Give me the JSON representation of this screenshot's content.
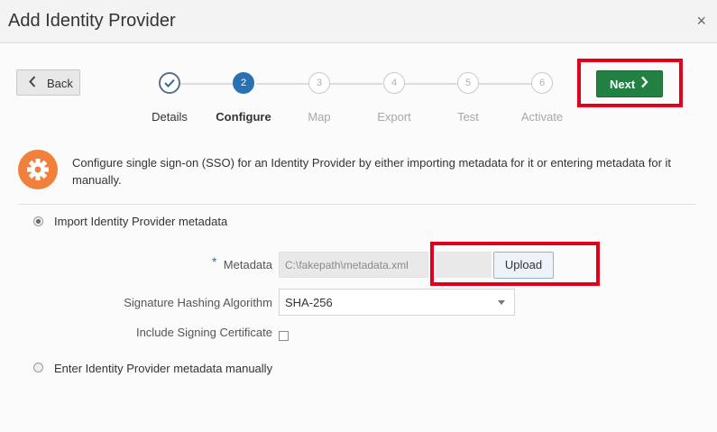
{
  "dialog": {
    "title": "Add Identity Provider",
    "close_glyph": "×"
  },
  "nav": {
    "back_label": "Back",
    "next_label": "Next"
  },
  "train": {
    "steps": [
      {
        "label": "Details",
        "number": "1",
        "state": "done"
      },
      {
        "label": "Configure",
        "number": "2",
        "state": "current"
      },
      {
        "label": "Map",
        "number": "3",
        "state": "future"
      },
      {
        "label": "Export",
        "number": "4",
        "state": "future"
      },
      {
        "label": "Test",
        "number": "5",
        "state": "future"
      },
      {
        "label": "Activate",
        "number": "6",
        "state": "future"
      }
    ]
  },
  "info": {
    "icon": "gear-icon",
    "text": "Configure single sign-on (SSO) for an Identity Provider by either importing metadata for it or entering metadata for it manually."
  },
  "options": {
    "import_label": "Import Identity Provider metadata",
    "import_selected": true,
    "manual_label": "Enter Identity Provider metadata manually",
    "manual_selected": false
  },
  "form": {
    "metadata_label": "Metadata",
    "required_marker": "*",
    "metadata_value": "C:\\fakepath\\metadata.xml",
    "upload_label": "Upload",
    "hash_label": "Signature Hashing Algorithm",
    "hash_value": "SHA-256",
    "signing_label": "Include Signing Certificate",
    "signing_checked": false
  },
  "colors": {
    "accent_blue": "#2a71b4",
    "next_green": "#238043",
    "highlight_red": "#e0001b",
    "info_orange": "#f0803c"
  }
}
